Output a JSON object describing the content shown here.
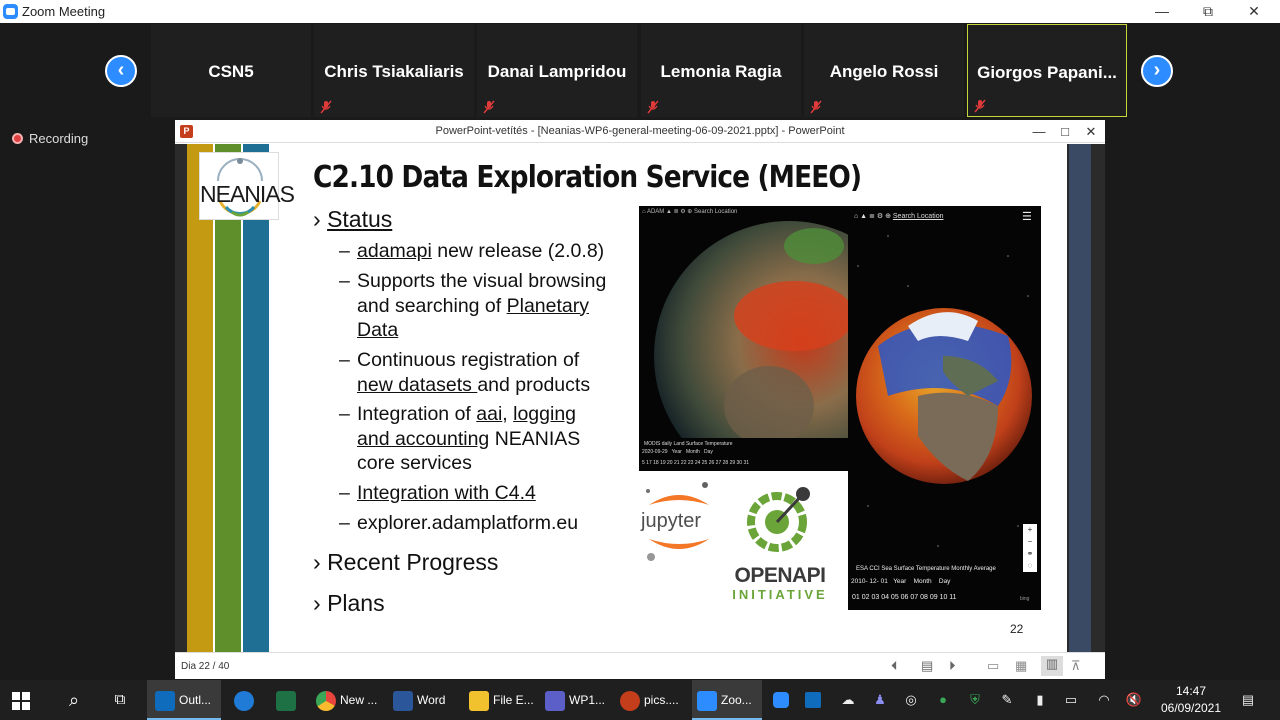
{
  "window": {
    "title": "Zoom Meeting"
  },
  "participants": [
    {
      "name": "CSN5",
      "muted": false
    },
    {
      "name": "Chris Tsiakaliaris",
      "muted": true
    },
    {
      "name": "Danai Lampridou",
      "muted": true
    },
    {
      "name": "Lemonia Ragia",
      "muted": true
    },
    {
      "name": "Angelo Rossi",
      "muted": true
    },
    {
      "name": "Giorgos  Papani...",
      "muted": true,
      "speaking": true
    }
  ],
  "recording": {
    "label": "Recording"
  },
  "powerpoint": {
    "title": "PowerPoint-vetítés - [Neanias-WP6-general-meeting-06-09-2021.pptx] - PowerPoint",
    "status": "Dia 22 / 40"
  },
  "slide": {
    "logo_text": "NEANIAS",
    "title": "C2.10  Data Exploration Service (MEEO)",
    "status_heading": "Status",
    "bullets": {
      "b1_link": "adamapi",
      "b1_rest": " new release (2.0.8)",
      "b2_a": "Supports the visual browsing and searching of ",
      "b2_link": "Planetary Data",
      "b3_a": "Continuous registration of ",
      "b3_link": "new datasets ",
      "b3_rest": "and products",
      "b4_a": "Integration of ",
      "b4_link1": "aai",
      "b4_comma": ", ",
      "b4_link2": "logging and accounting",
      "b4_rest": " NEANIAS core services",
      "b5_link": "Integration with C4.4",
      "b6": "explorer.adamplatform.eu"
    },
    "recent_progress": "Recent Progress",
    "plans": "Plans",
    "page_number": "22",
    "screenshot1": {
      "search": "Search Location",
      "legend": "MODIS daily Land Surface Temperature",
      "date": "2020-09-29",
      "tabs": [
        "Year",
        "Month",
        "Day"
      ],
      "days": "5  17  18  19  20  21  22  23  24  25  26  27  28  29  30  31"
    },
    "screenshot2": {
      "search": "Search Location",
      "legend": "ESA CCI Sea Surface Temperature Monthly Average",
      "date": "2010- 12- 01",
      "tabs": [
        "Year",
        "Month",
        "Day"
      ],
      "months": "01  02  03  04  05  06  07  08  09  10  11",
      "credit": "bing"
    },
    "jupyter": "jupyter",
    "openapi": {
      "top": "OPENAPI",
      "bottom": "INITIATIVE"
    }
  },
  "taskbar": {
    "apps": [
      {
        "label": "Outl...",
        "color": "#0f6cbd",
        "icon": "outlook-icon"
      },
      {
        "label": "",
        "color": "#1f7bd6",
        "icon": "edge-icon"
      },
      {
        "label": "",
        "color": "#1e7145",
        "icon": "excel-icon"
      },
      {
        "label": "New ...",
        "color": "#e8453c",
        "icon": "chrome-icon"
      },
      {
        "label": "Word",
        "color": "#2b579a",
        "icon": "word-icon"
      },
      {
        "label": "File E...",
        "color": "#f2c12e",
        "icon": "file-explorer-icon"
      },
      {
        "label": "WP1...",
        "color": "#5b5fc7",
        "icon": "teams-icon"
      },
      {
        "label": "pics....",
        "color": "#c43e1c",
        "icon": "powerpoint-icon"
      },
      {
        "label": "Zoo...",
        "color": "#2d8cff",
        "icon": "zoom-icon"
      }
    ],
    "time": "14:47",
    "date": "06/09/2021"
  }
}
